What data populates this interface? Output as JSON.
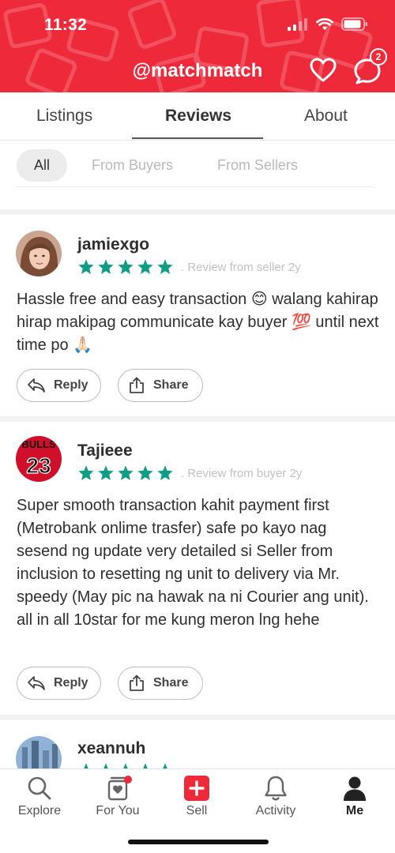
{
  "status_bar": {
    "time": "11:32"
  },
  "header": {
    "title": "@matchmatch",
    "chat_badge": "2"
  },
  "tabs": [
    {
      "label": "Listings"
    },
    {
      "label": "Reviews"
    },
    {
      "label": "About"
    }
  ],
  "filters": [
    {
      "label": "All"
    },
    {
      "label": "From Buyers"
    },
    {
      "label": "From Sellers"
    }
  ],
  "reviews": [
    {
      "username": "jamiexgo",
      "stars": 5,
      "meta": ". Review from seller  2y",
      "text": "Hassle free and easy transaction 😊 walang kahirap hirap makipag communicate kay buyer 💯 until next time po 🙏🏻",
      "reply_label": "Reply",
      "share_label": "Share"
    },
    {
      "username": "Tajieee",
      "stars": 5,
      "meta": ". Review from buyer  2y",
      "text": "Super smooth transaction kahit payment first (Metrobank onlime trasfer) safe po kayo nag sesend ng update very detailed si Seller from inclusion to resetting ng unit to delivery via Mr. speedy (May pic na hawak na ni Courier ang unit). all in all 10star for me kung meron lng hehe",
      "reply_label": "Reply",
      "share_label": "Share"
    },
    {
      "username": "xeannuh",
      "stars": 5
    }
  ],
  "bottom_nav": [
    {
      "label": "Explore",
      "icon": "search-icon"
    },
    {
      "label": "For You",
      "icon": "for-you-icon"
    },
    {
      "label": "Sell",
      "icon": "sell-plus-icon"
    },
    {
      "label": "Activity",
      "icon": "bell-icon"
    },
    {
      "label": "Me",
      "icon": "profile-icon"
    }
  ],
  "colors": {
    "brand": "#ee2a3a",
    "star": "#0f9d84"
  }
}
